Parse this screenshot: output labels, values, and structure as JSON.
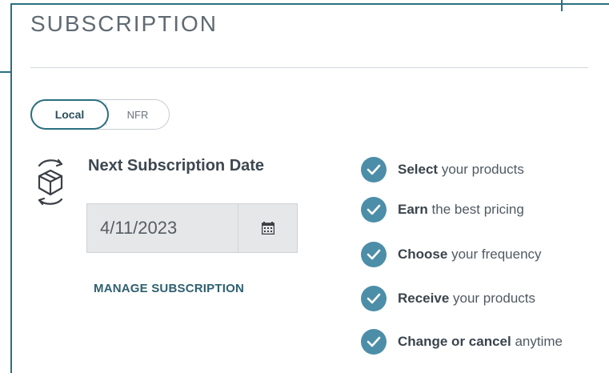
{
  "header": {
    "title": "SUBSCRIPTION"
  },
  "toggle": {
    "options": [
      {
        "label": "Local",
        "active": true
      },
      {
        "label": "NFR",
        "active": false
      }
    ]
  },
  "schedule": {
    "label": "Next Subscription Date",
    "date_value": "4/11/2023",
    "calendar_icon": "calendar-icon",
    "manage_label": "MANAGE SUBSCRIPTION"
  },
  "benefits": [
    {
      "bold": "Select",
      "rest": " your products"
    },
    {
      "bold": "Earn",
      "rest": " the best pricing"
    },
    {
      "bold": "Choose",
      "rest": " your frequency"
    },
    {
      "bold": "Receive",
      "rest": " your products"
    },
    {
      "bold": "Change or cancel",
      "rest": " anytime"
    }
  ],
  "colors": {
    "accent": "#2b6f80",
    "check": "#4c8ea8",
    "field_bg": "#e6e7e8"
  }
}
